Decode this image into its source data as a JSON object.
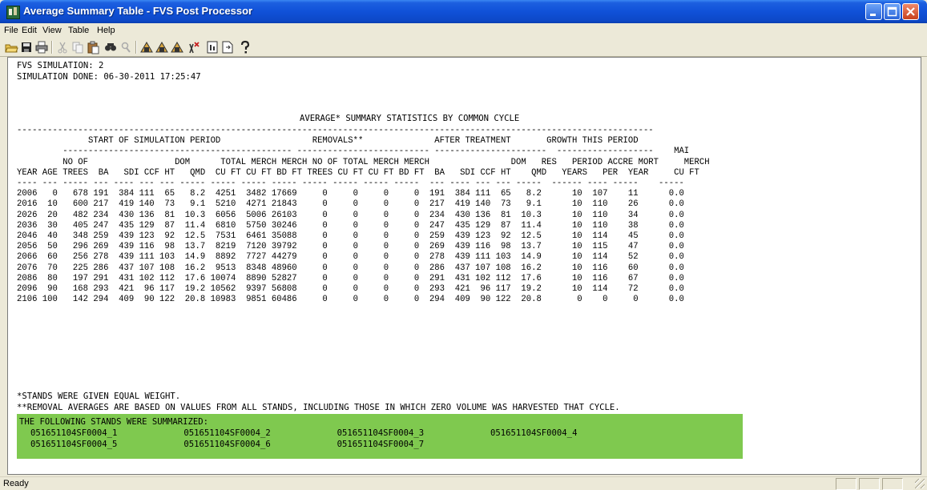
{
  "window": {
    "title": "Average Summary Table - FVS Post Processor",
    "controls": [
      "minimize-icon",
      "maximize-icon",
      "close-icon"
    ]
  },
  "menu": {
    "items": [
      "File",
      "Edit",
      "View",
      "Table",
      "Help"
    ]
  },
  "toolbar": {
    "icons": [
      "open-icon",
      "save-icon",
      "print-icon",
      "cut-icon",
      "copy-icon",
      "paste-icon",
      "find-icon",
      "find-next-icon",
      "chart-icon-1",
      "chart-icon-2",
      "chart-icon-3",
      "delete-icon",
      "page-setup-icon",
      "export-icon",
      "help-icon"
    ]
  },
  "report": {
    "header_line_1": "FVS SIMULATION: 2",
    "header_line_2": "SIMULATION DONE: 06-30-2011 17:25:47",
    "title": "AVERAGE* SUMMARY STATISTICS BY COMMON CYCLE",
    "table_text": "-----------------------------------------------------------------------------------------------------------------------------\n              START OF SIMULATION PERIOD                  REMOVALS**              AFTER TREATMENT       GROWTH THIS PERIOD\n         --------------------------------------------- -------------------------- ----------------------  -------------------    MAI\n         NO OF                 DOM      TOTAL MERCH MERCH NO OF TOTAL MERCH MERCH                DOM   RES   PERIOD ACCRE MORT     MERCH\nYEAR AGE TREES  BA   SDI CCF HT   QMD  CU FT CU FT BD FT TREES CU FT CU FT BD FT  BA   SDI CCF HT    QMD   YEARS   PER  YEAR     CU FT\n---- --- ----- --- ---- --- --- ----- ----- ----- ----- ----- ----- ----- -----  --- ---- --- --- -----  ------ ---- -----    -----\n2006   0   678 191  384 111  65   8.2  4251  3482 17669     0     0     0     0  191  384 111  65   8.2      10  107    11      0.0\n2016  10   600 217  419 140  73   9.1  5210  4271 21843     0     0     0     0  217  419 140  73   9.1      10  110    26      0.0\n2026  20   482 234  430 136  81  10.3  6056  5006 26103     0     0     0     0  234  430 136  81  10.3      10  110    34      0.0\n2036  30   405 247  435 129  87  11.4  6810  5750 30246     0     0     0     0  247  435 129  87  11.4      10  110    38      0.0\n2046  40   348 259  439 123  92  12.5  7531  6461 35088     0     0     0     0  259  439 123  92  12.5      10  114    45      0.0\n2056  50   296 269  439 116  98  13.7  8219  7120 39792     0     0     0     0  269  439 116  98  13.7      10  115    47      0.0\n2066  60   256 278  439 111 103  14.9  8892  7727 44279     0     0     0     0  278  439 111 103  14.9      10  114    52      0.0\n2076  70   225 286  437 107 108  16.2  9513  8348 48960     0     0     0     0  286  437 107 108  16.2      10  116    60      0.0\n2086  80   197 291  431 102 112  17.6 10074  8890 52827     0     0     0     0  291  431 102 112  17.6      10  116    67      0.0\n2096  90   168 293  421  96 117  19.2 10562  9397 56808     0     0     0     0  293  421  96 117  19.2      10  114    72      0.0\n2106 100   142 294  409  90 122  20.8 10983  9851 60486     0     0     0     0  294  409  90 122  20.8       0    0     0      0.0",
    "footnote_1": "*STANDS WERE GIVEN EQUAL WEIGHT.",
    "footnote_2": "**REMOVAL AVERAGES ARE BASED ON VALUES FROM ALL STANDS, INCLUDING THOSE IN WHICH ZERO VOLUME WAS HARVESTED THAT CYCLE.",
    "stands_heading": "THE FOLLOWING STANDS WERE SUMMARIZED:",
    "stands_row_1": "051651104SF0004_1             051651104SF0004_2             051651104SF0004_3             051651104SF0004_4",
    "stands_row_2": "051651104SF0004_5             051651104SF0004_6             051651104SF0004_7",
    "highlight_color": "#7fc94f"
  },
  "status": {
    "text": "Ready"
  }
}
